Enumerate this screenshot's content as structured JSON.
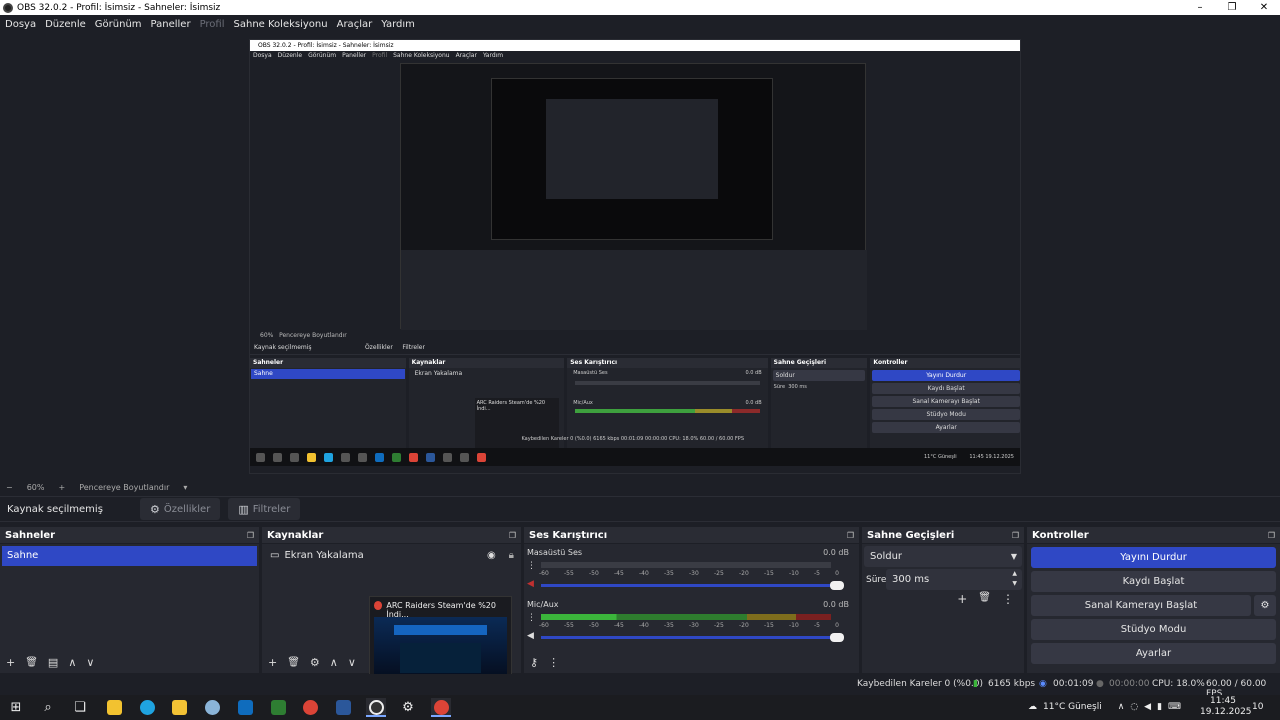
{
  "window": {
    "title": "OBS 32.0.2 - Profil: İsimsiz - Sahneler: İsimsiz",
    "controls": [
      "–",
      "❐",
      "✕"
    ]
  },
  "menu": [
    {
      "label": "Dosya",
      "disabled": false
    },
    {
      "label": "Düzenle",
      "disabled": false
    },
    {
      "label": "Görünüm",
      "disabled": false
    },
    {
      "label": "Paneller",
      "disabled": false
    },
    {
      "label": "Profil",
      "disabled": true
    },
    {
      "label": "Sahne Koleksiyonu",
      "disabled": false
    },
    {
      "label": "Araçlar",
      "disabled": false
    },
    {
      "label": "Yardım",
      "disabled": false
    }
  ],
  "preview_capture": {
    "title": "OBS 32.0.2 - Profil: İsimsiz - Sahneler: İsimsiz",
    "menu": [
      "Dosya",
      "Düzenle",
      "Görünüm",
      "Paneller",
      "Profil",
      "Sahne Koleksiyonu",
      "Araçlar",
      "Yardım"
    ],
    "zoom": "60%",
    "fit": "Pencereye Boyutlandır",
    "no_source": "Kaynak seçilmemiş",
    "properties": "Özellikler",
    "filters": "Filtreler",
    "docks": {
      "scenes": "Sahneler",
      "scene": "Sahne",
      "sources": "Kaynaklar",
      "source": "Ekran Yakalama",
      "mixer": "Ses Karıştırıcı",
      "desktop": "Masaüstü Ses",
      "mic": "Mic/Aux",
      "db": "0.0 dB",
      "transitions": "Sahne Geçişleri",
      "fade": "Soldur",
      "duration_label": "Süre",
      "duration": "300 ms",
      "controls": "Kontroller",
      "stop_stream": "Yayını Durdur",
      "start_rec": "Kaydı Başlat",
      "virtual_cam": "Sanal Kamerayı Başlat",
      "studio": "Stüdyo Modu",
      "settings": "Ayarlar"
    },
    "popup": "ARC Raiders Steam'de %20 İndi...",
    "status": "Kaybedilen Kareler 0 (%0.0)   6165 kbps   00:01:09   00:00:00   CPU: 18.0%   60.00 / 60.00 FPS",
    "weather": "11°C Güneşli",
    "time": "11:45",
    "date": "19.12.2025"
  },
  "zoom_row": {
    "minus": "−",
    "zoom": "60%",
    "plus": "+",
    "fit": "Pencereye Boyutlandır",
    "caret": "▾"
  },
  "source_toolbar": {
    "no_source": "Kaynak seçilmemiş",
    "properties": "Özellikler",
    "filters": "Filtreler"
  },
  "scenes": {
    "title": "Sahneler",
    "items": [
      "Sahne"
    ],
    "footer": [
      "+",
      "🗑",
      "▤",
      "∧",
      "∨"
    ]
  },
  "sources": {
    "title": "Kaynaklar",
    "items": [
      {
        "label": "Ekran Yakalama",
        "visible_icon": "eye-icon",
        "lock_icon": "lock-icon"
      }
    ],
    "footer": [
      "+",
      "🗑",
      "⚙",
      "∧",
      "∨"
    ]
  },
  "taskbar_popup": {
    "title": "ARC Raiders Steam'de %20 İndi..."
  },
  "mixer": {
    "title": "Ses Karıştırıcı",
    "channels": [
      {
        "name": "Masaüstü Ses",
        "db": "0.0 dB",
        "active": false
      },
      {
        "name": "Mic/Aux",
        "db": "0.0 dB",
        "active": true
      }
    ],
    "scale": [
      "-60",
      "-55",
      "-50",
      "-45",
      "-40",
      "-35",
      "-30",
      "-25",
      "-20",
      "-15",
      "-10",
      "-5",
      "0"
    ]
  },
  "transitions": {
    "title": "Sahne Geçişleri",
    "selected": "Soldur",
    "duration_label": "Süre",
    "duration": "300 ms"
  },
  "controls": {
    "title": "Kontroller",
    "stop_stream": "Yayını Durdur",
    "start_recording": "Kaydı Başlat",
    "virtual_cam": "Sanal Kamerayı Başlat",
    "studio_mode": "Stüdyo Modu",
    "settings": "Ayarlar"
  },
  "status": {
    "dropped": "Kaybedilen Kareler 0 (%0.0)",
    "bitrate": "6165 kbps",
    "stream_time": "00:01:09",
    "rec_time": "00:00:00",
    "cpu": "CPU: 18.0%",
    "fps": "60.00 / 60.00 FPS"
  },
  "taskbar": {
    "weather": "11°C  Güneşli",
    "time": "11:45",
    "date": "19.12.2025",
    "notif": "10",
    "colors": {
      "explorer": "#f2c230",
      "edge": "#1fa3e0",
      "store": "#f3c235",
      "outlook": "#0f6cbd",
      "calc": "#2e7d32",
      "chrome": "#db4437",
      "word": "#2b579a",
      "obs": "#333333"
    }
  }
}
